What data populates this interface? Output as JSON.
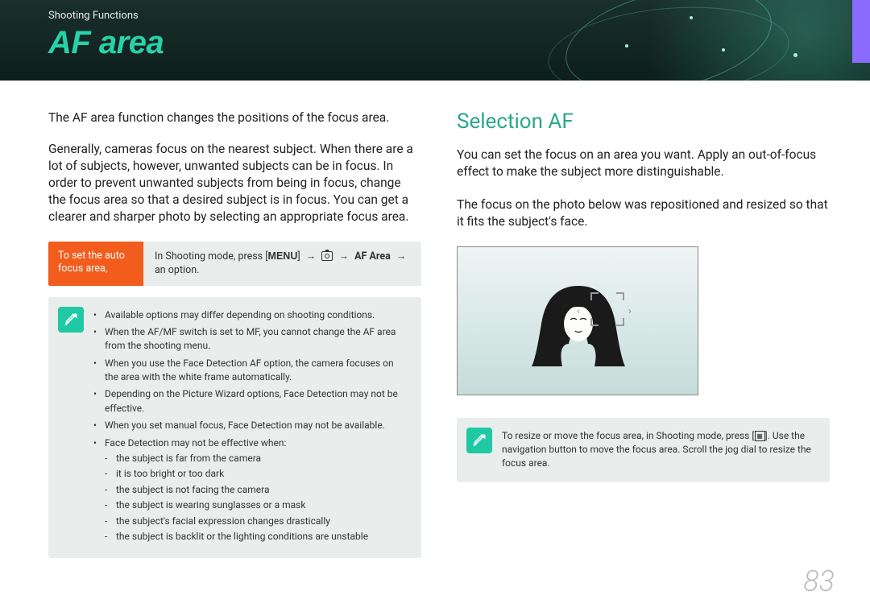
{
  "header": {
    "section": "Shooting Functions",
    "title": "AF area"
  },
  "left": {
    "intro": "The AF area function changes the positions of the focus area.",
    "body": "Generally, cameras focus on the nearest subject. When there are a lot of subjects, however, unwanted subjects can be in focus. In order to prevent unwanted subjects from being in focus, change the focus area so that a desired subject is in focus. You can get a clearer and sharper photo by selecting an appropriate focus area.",
    "instr_label": "To set the auto focus area,",
    "instr_prefix": "In Shooting mode, press [",
    "instr_menu": "MENU",
    "instr_afarea": "AF Area",
    "instr_suffix": "an option.",
    "notes": [
      "Available options may differ depending on shooting conditions.",
      "When the AF/MF switch is set to MF, you cannot change the AF area from the shooting menu.",
      "When you use the Face Detection AF option, the camera focuses on the area with the white frame automatically.",
      "Depending on the Picture Wizard options, Face Detection may not be effective.",
      "When you set manual focus, Face Detection may not be available.",
      "Face Detection may not be effective when:"
    ],
    "subnotes": [
      "the subject is far from the camera",
      "it is too bright or too dark",
      "the subject is not facing the camera",
      "the subject is wearing sunglasses or a mask",
      "the subject's facial expression changes drastically",
      "the subject is backlit or the lighting conditions are unstable"
    ]
  },
  "right": {
    "heading": "Selection AF",
    "p1": "You can set the focus on an area you want. Apply an out-of-focus effect to make the subject more distinguishable.",
    "p2": "The focus on the photo below was repositioned and resized so that it fits the subject's face.",
    "note": "To resize or move the focus area, in Shooting mode, press [",
    "note2": "]. Use the navigation button to move the focus area. Scroll the jog dial to resize the focus area."
  },
  "page_number": "83"
}
